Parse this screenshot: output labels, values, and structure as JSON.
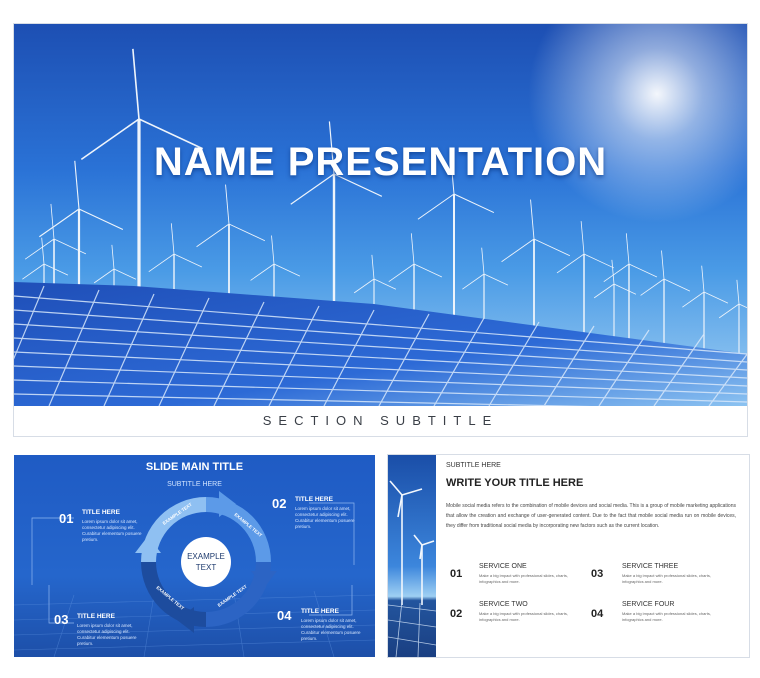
{
  "main": {
    "title": "NAME PRESENTATION",
    "subtitle": "SECTION SUBTITLE"
  },
  "slide2": {
    "title": "SLIDE MAIN TITLE",
    "subtitle": "SUBTITLE HERE",
    "center_line1": "EXAMPLE",
    "center_line2": "TEXT",
    "arrow_label": "EXAMPLE TEXT",
    "steps": [
      {
        "num": "01",
        "title": "TITLE HERE",
        "body": "Lorem ipsum dolor sit amet, consectetur adipiscing elit. Curabitur elementum posuere pretium."
      },
      {
        "num": "02",
        "title": "TITLE HERE",
        "body": "Lorem ipsum dolor sit amet, consectetur adipiscing elit. Curabitur elementum posuere pretium."
      },
      {
        "num": "03",
        "title": "TITLE HERE",
        "body": "Lorem ipsum dolor sit amet, consectetur adipiscing elit. Curabitur elementum posuere pretium."
      },
      {
        "num": "04",
        "title": "TITLE HERE",
        "body": "Lorem ipsum dolor sit amet, consectetur adipiscing elit. Curabitur elementum posuere pretium."
      }
    ]
  },
  "slide3": {
    "subtitle": "SUBTITLE HERE",
    "title": "WRITE YOUR TITLE HERE",
    "paragraph": "Mobile social media refers to the combination of mobile devices and social media. This is a group of mobile marketing applications that allow the creation and exchange of user-generated content. Due to the fact that mobile social media run on mobile devices, they differ from traditional social media by incorporating new factors such as the current location.",
    "services": [
      {
        "num": "01",
        "title": "SERVICE ONE",
        "body": "Make a big impact with professional slides, charts, infographics and more."
      },
      {
        "num": "02",
        "title": "SERVICE TWO",
        "body": "Make a big impact with professional slides, charts, infographics and more."
      },
      {
        "num": "03",
        "title": "SERVICE THREE",
        "body": "Make a big impact with professional slides, charts, infographics and more."
      },
      {
        "num": "04",
        "title": "SERVICE FOUR",
        "body": "Make a big impact with professional slides, charts, infographics and more."
      }
    ]
  }
}
